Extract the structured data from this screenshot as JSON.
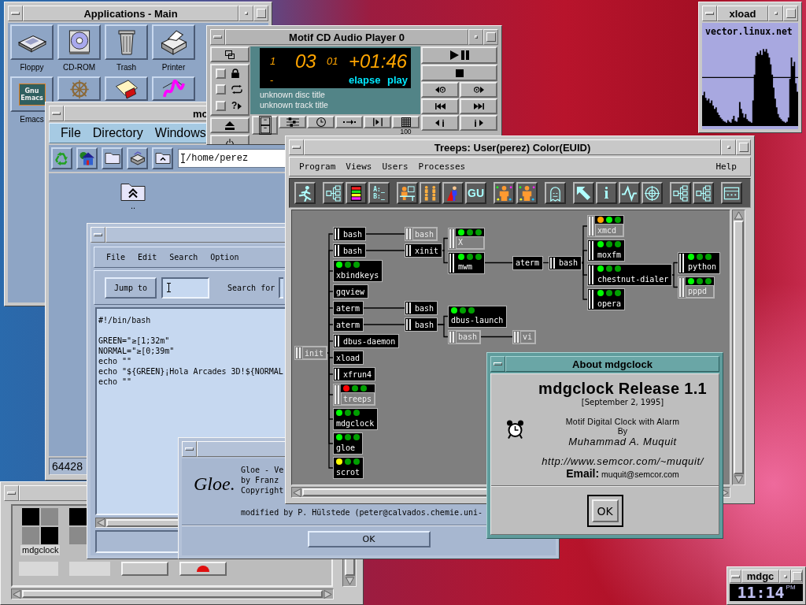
{
  "applications": {
    "title": "Applications - Main",
    "icons": [
      {
        "kind": "floppy",
        "label": "Floppy"
      },
      {
        "kind": "cdrom",
        "label": "CD-ROM"
      },
      {
        "kind": "trash",
        "label": "Trash"
      },
      {
        "kind": "printer",
        "label": "Printer"
      },
      {
        "kind": "emacs",
        "label": "Emacs",
        "badge": "Gnu Emacs"
      },
      {
        "kind": "wheel"
      },
      {
        "kind": "document"
      },
      {
        "kind": "paint"
      }
    ]
  },
  "file_manager": {
    "title": "mo",
    "menu": [
      "File",
      "Directory",
      "Windows"
    ],
    "tools": [
      {
        "kind": "recycle"
      },
      {
        "kind": "house"
      },
      {
        "kind": "folder"
      },
      {
        "kind": "drive"
      },
      {
        "kind": "folder-up"
      }
    ],
    "path": "/home/perez",
    "entries": [
      {
        "kind": "folder-up",
        "label": ".."
      }
    ],
    "status": "64428"
  },
  "icon_box": {
    "icons": [
      {
        "kind": "clock-grid",
        "label": "mdgclock"
      },
      {
        "kind": "clock-grid"
      }
    ]
  },
  "editor": {
    "menu": [
      "File",
      "Edit",
      "Search",
      "Option"
    ],
    "jump_button": "Jump to",
    "search_label": "Search for",
    "blocks": [
      [
        "#!/bin/bash"
      ],
      [
        "GREEN=\"≥[1;32m\"",
        "NORMAL=\"≥[0;39m\"",
        "echo \"\"",
        "echo \"${GREEN}¡Hola Arcades 3D!${NORMAL",
        "echo \"\""
      ]
    ]
  },
  "gloe": {
    "logo": "Gloe.",
    "lines": [
      "Gloe - Ve",
      "by Franz",
      "Copyright"
    ],
    "credit": "modified by P. Hülstede (peter@calvados.chemie.uni-",
    "ok": "OK"
  },
  "cd_player": {
    "title": "Motif CD Audio Player 0",
    "track_small": "1",
    "track": "03",
    "index": "01",
    "time": "+01:46",
    "dash": "-",
    "time_mode": "elapse",
    "status": "play",
    "disc_title": "unknown disc title",
    "track_title": "unknown track title",
    "options": [
      {
        "kind": "lock",
        "checked": false
      },
      {
        "kind": "repeat",
        "checked": false
      },
      {
        "kind": "random",
        "glyph": "?",
        "checked": false
      }
    ],
    "transport": [
      {
        "kind": "play-pause"
      },
      {
        "kind": "stop"
      },
      {
        "kind": "rewind"
      },
      {
        "kind": "fast-forward"
      },
      {
        "kind": "previous-track"
      },
      {
        "kind": "next-track"
      },
      {
        "kind": "previous-index",
        "text": "i"
      },
      {
        "kind": "next-index",
        "text": "i"
      }
    ],
    "tools": [
      {
        "kind": "cabinet"
      },
      {
        "kind": "mixer"
      },
      {
        "kind": "clock"
      },
      {
        "kind": "arrow"
      },
      {
        "kind": "split"
      },
      {
        "kind": "grid"
      }
    ],
    "volume": "100"
  },
  "treeps": {
    "title": "Treeps: User(perez) Color(EUID)",
    "menu": [
      "Program",
      "Views",
      "Users",
      "Processes"
    ],
    "help": "Help",
    "toolbar": [
      [
        {
          "kind": "runner"
        }
      ],
      [
        {
          "kind": "tree"
        },
        {
          "kind": "colors"
        },
        {
          "kind": "drives",
          "text": "A:_ B:_"
        }
      ],
      [
        {
          "kind": "desk"
        },
        {
          "kind": "group"
        },
        {
          "kind": "hero"
        },
        {
          "kind": "label",
          "text": "GU"
        }
      ],
      [
        {
          "kind": "person"
        },
        {
          "kind": "person"
        }
      ],
      [
        {
          "kind": "ghost"
        }
      ],
      [
        {
          "kind": "pointer"
        },
        {
          "kind": "glyph",
          "text": "i"
        },
        {
          "kind": "wave"
        },
        {
          "kind": "target"
        }
      ],
      [
        {
          "kind": "tree"
        },
        {
          "kind": "tree"
        }
      ],
      [
        {
          "kind": "panel"
        }
      ]
    ],
    "tree": {
      "name": "init",
      "bars": true,
      "dimmed": true,
      "children": [
        {
          "name": "bash",
          "bars": true,
          "dimmed": false,
          "children": [
            {
              "name": "bash",
              "bars": true,
              "dimmed": true
            }
          ]
        },
        {
          "name": "bash",
          "bars": true,
          "dimmed": false,
          "children": [
            {
              "name": "xinit",
              "bars": true,
              "dimmed": false,
              "children": [
                {
                  "name": "X",
                  "bars": true,
                  "dimmed": true,
                  "lights": [
                    {
                      "color": "#00ff00"
                    },
                    {
                      "color": "#00a000"
                    },
                    {
                      "color": "#00a000"
                    }
                  ]
                },
                {
                  "name": "mwm",
                  "bars": true,
                  "dimmed": false,
                  "lights": [
                    {
                      "color": "#00ff00"
                    },
                    {
                      "color": "#00a000"
                    },
                    {
                      "color": "#00a000"
                    }
                  ],
                  "children": [
                    {
                      "name": "aterm",
                      "bars": false,
                      "dimmed": false,
                      "children": [
                        {
                          "name": "bash",
                          "bars": true,
                          "dimmed": false,
                          "children": [
                            {
                              "name": "xmcd",
                              "bars": true,
                              "dimmed": true,
                              "lights": [
                                {
                                  "color": "#ffa500"
                                },
                                {
                                  "color": "#00ff00"
                                },
                                {
                                  "color": "#00a000"
                                }
                              ]
                            },
                            {
                              "name": "moxfm",
                              "bars": true,
                              "dimmed": false,
                              "lights": [
                                {
                                  "color": "#00ff00"
                                },
                                {
                                  "color": "#00a000"
                                },
                                {
                                  "color": "#00a000"
                                }
                              ]
                            },
                            {
                              "name": "chestnut-dialer",
                              "bars": true,
                              "dimmed": false,
                              "lights": [
                                {
                                  "color": "#00ff00"
                                },
                                {
                                  "color": "#00a000"
                                },
                                {
                                  "color": "#00a000"
                                }
                              ],
                              "children": [
                                {
                                  "name": "python",
                                  "bars": true,
                                  "dimmed": false,
                                  "lights": [
                                    {
                                      "color": "#00ff00"
                                    },
                                    {
                                      "color": "#00a000"
                                    },
                                    {
                                      "color": "#00a000"
                                    }
                                  ]
                                },
                                {
                                  "name": "pppd",
                                  "bars": true,
                                  "dimmed": true,
                                  "lights": [
                                    {
                                      "color": "#00ff00"
                                    },
                                    {
                                      "color": "#00a000"
                                    },
                                    {
                                      "color": "#00a000"
                                    }
                                  ]
                                }
                              ]
                            },
                            {
                              "name": "opera",
                              "bars": true,
                              "dimmed": false,
                              "lights": [
                                {
                                  "color": "#00ff00"
                                },
                                {
                                  "color": "#00a000"
                                },
                                {
                                  "color": "#00a000"
                                }
                              ]
                            }
                          ]
                        }
                      ]
                    }
                  ]
                }
              ]
            }
          ]
        },
        {
          "name": "xbindkeys",
          "bars": false,
          "dimmed": false,
          "lights": [
            {
              "color": "#00ff00"
            },
            {
              "color": "#00a000"
            },
            {
              "color": "#00a000"
            }
          ]
        },
        {
          "name": "gqview",
          "bars": false,
          "dimmed": false
        },
        {
          "name": "aterm",
          "bars": false,
          "dimmed": false,
          "children": [
            {
              "name": "bash",
              "bars": true,
              "dimmed": false
            }
          ]
        },
        {
          "name": "aterm",
          "bars": false,
          "dimmed": false,
          "children": [
            {
              "name": "bash",
              "bars": true,
              "dimmed": false,
              "children": [
                {
                  "name": "dbus-launch",
                  "bars": false,
                  "dimmed": false,
                  "lights": [
                    {
                      "color": "#00ff00"
                    },
                    {
                      "color": "#00a000"
                    },
                    {
                      "color": "#00a000"
                    }
                  ]
                },
                {
                  "name": "bash",
                  "bars": true,
                  "dimmed": true,
                  "children": [
                    {
                      "name": "vi",
                      "bars": true,
                      "dimmed": true
                    }
                  ]
                }
              ]
            }
          ]
        },
        {
          "name": "dbus-daemon",
          "bars": true,
          "dimmed": false
        },
        {
          "name": "xload",
          "bars": false,
          "dimmed": false
        },
        {
          "name": "xfrun4",
          "bars": true,
          "dimmed": false
        },
        {
          "name": "treeps",
          "bars": true,
          "dimmed": true,
          "lights": [
            {
              "color": "#ff0000"
            },
            {
              "color": "#00a000"
            },
            {
              "color": "#00a000"
            }
          ]
        },
        {
          "name": "mdgclock",
          "bars": false,
          "dimmed": false,
          "lights": [
            {
              "color": "#00ff00"
            },
            {
              "color": "#00a000"
            },
            {
              "color": "#00a000"
            }
          ]
        },
        {
          "name": "gloe",
          "bars": false,
          "dimmed": false,
          "lights": [
            {
              "color": "#00ff00"
            },
            {
              "color": "#00a000"
            },
            {
              "color": "#00a000"
            }
          ]
        },
        {
          "name": "scrot",
          "bars": false,
          "dimmed": false,
          "lights": [
            {
              "color": "#ffff00"
            },
            {
              "color": "#00a000"
            },
            {
              "color": "#00a000"
            }
          ]
        }
      ]
    }
  },
  "about": {
    "title": "About mdgclock",
    "heading": "mdgclock Release 1.1",
    "date": "[September 2, 1995]",
    "description": "Motif Digital Clock with Alarm",
    "by": "By",
    "author": "Muhammad A. Muquit",
    "url": "http://www.semcor.com/~muquit/",
    "email": "**Email:** muquit@semcor.com",
    "ok": "OK"
  },
  "xload": {
    "title": "xload",
    "host": "vector.linux.net"
  },
  "clock": {
    "title": "mdgc",
    "time": "11:14",
    "meridiem": "PM"
  }
}
